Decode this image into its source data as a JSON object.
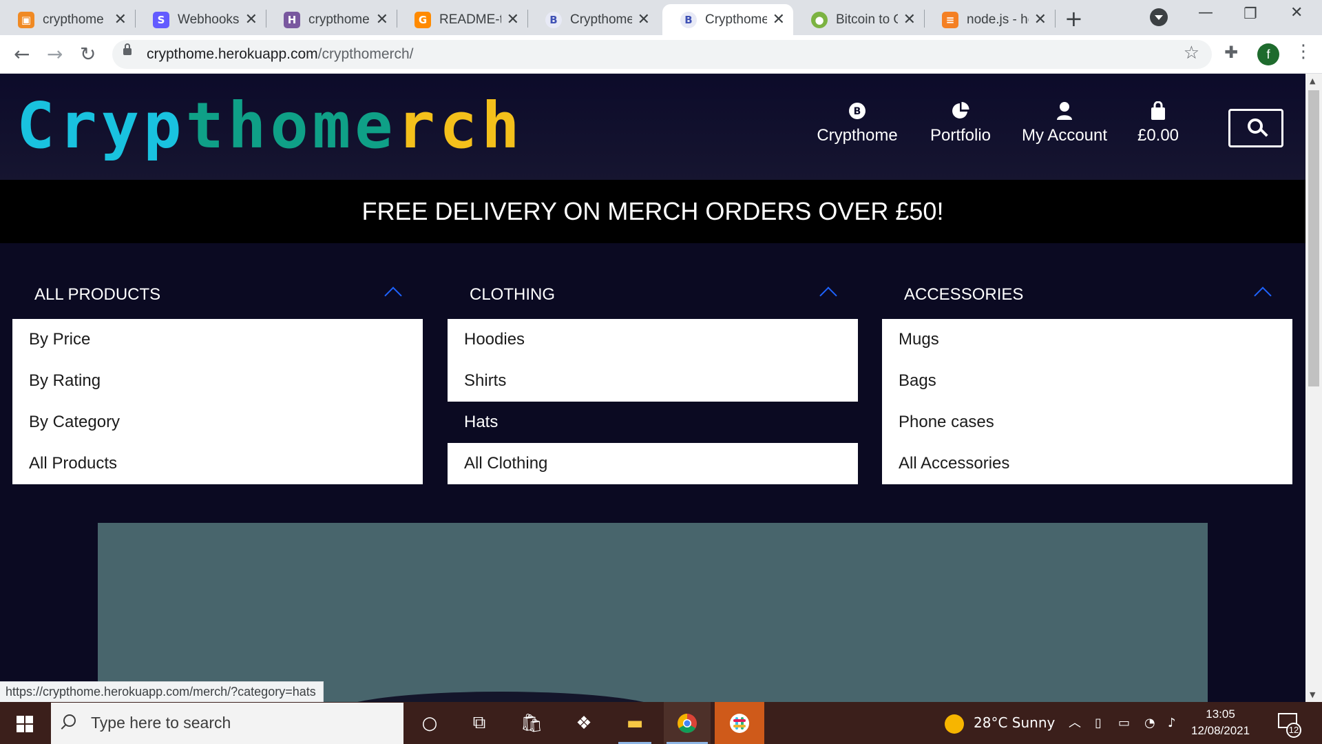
{
  "browser": {
    "tabs": [
      {
        "title": "crypthome",
        "favicon": "box-icon",
        "color": "#f08a24"
      },
      {
        "title": "Webhooks",
        "favicon": "stripe-icon",
        "color": "#635bff"
      },
      {
        "title": "crypthome",
        "favicon": "heroku-icon",
        "color": "#79589f"
      },
      {
        "title": "README-te",
        "favicon": "gitpod-icon",
        "color": "#ff8a00"
      },
      {
        "title": "Crypthome",
        "favicon": "bitcoin-icon",
        "color": "#3f51b5"
      },
      {
        "title": "Crypthome",
        "favicon": "bitcoin-icon",
        "color": "#3f51b5"
      },
      {
        "title": "Bitcoin to G",
        "favicon": "coin-icon",
        "color": "#7cb342"
      },
      {
        "title": "node.js - he",
        "favicon": "stackoverflow-icon",
        "color": "#f48024"
      }
    ],
    "active_tab": 5,
    "new_tab_glyph": "+",
    "url_host": "crypthome.herokuapp.com",
    "url_path": "/crypthomerch/",
    "profile_initial": "f",
    "status_url": "https://crypthome.herokuapp.com/merch/?category=hats"
  },
  "site": {
    "logo": {
      "part1": "Cryp",
      "part2": "thome",
      "part3": "rch"
    },
    "nav": [
      {
        "label": "Crypthome",
        "icon": "bitcoin-icon"
      },
      {
        "label": "Portfolio",
        "icon": "pie-chart-icon"
      },
      {
        "label": "My Account",
        "icon": "user-icon"
      },
      {
        "label": "£0.00",
        "icon": "shopping-bag-icon"
      }
    ],
    "banner": "FREE DELIVERY ON MERCH ORDERS OVER £50!",
    "menus": [
      {
        "title": "ALL PRODUCTS",
        "items": [
          "By Price",
          "By Rating",
          "By Category",
          "All Products"
        ]
      },
      {
        "title": "CLOTHING",
        "items": [
          "Hoodies",
          "Shirts",
          "Hats",
          "All Clothing"
        ]
      },
      {
        "title": "ACCESSORIES",
        "items": [
          "Mugs",
          "Bags",
          "Phone cases",
          "All Accessories"
        ]
      }
    ],
    "hovered_item": "Hats",
    "colors": {
      "logo_cyan": "#19c2df",
      "logo_green": "#0fa087",
      "logo_yellow": "#f4c01b",
      "chevron": "#1e63ff",
      "hero_bg": "#48656c"
    }
  },
  "taskbar": {
    "search_placeholder": "Type here to search",
    "weather": "28°C  Sunny",
    "time": "13:05",
    "date": "12/08/2021",
    "notification_count": "12"
  }
}
